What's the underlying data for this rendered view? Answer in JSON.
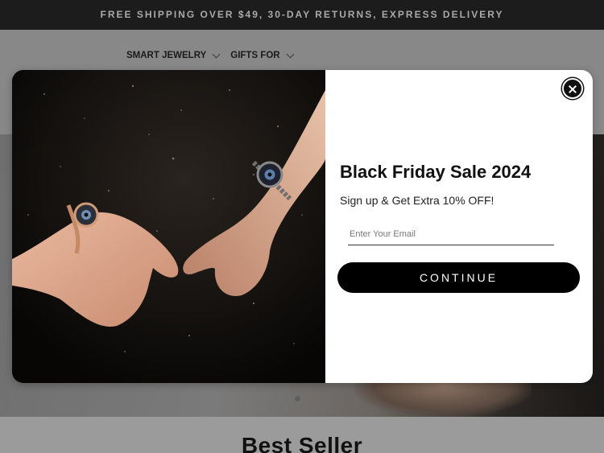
{
  "announcement": {
    "text": "FREE SHIPPING OVER $49, 30-DAY RETURNS, EXPRESS DELIVERY"
  },
  "nav": {
    "items": [
      {
        "label": "SMART JEWELRY",
        "icon": "chevron-down-icon"
      },
      {
        "label": "GIFTS FOR",
        "icon": "chevron-down-icon"
      }
    ]
  },
  "section": {
    "heading": "Best Seller"
  },
  "popup": {
    "title": "Black Friday Sale 2024",
    "subtitle": "Sign up & Get Extra 10% OFF!",
    "email_placeholder": "Enter Your Email",
    "email_value": "",
    "button_label": "CONTINUE",
    "close_icon": "close-icon"
  },
  "colors": {
    "announcement_bg": "#1c1c1c",
    "button_bg": "#000000",
    "modal_bg": "#ffffff"
  }
}
